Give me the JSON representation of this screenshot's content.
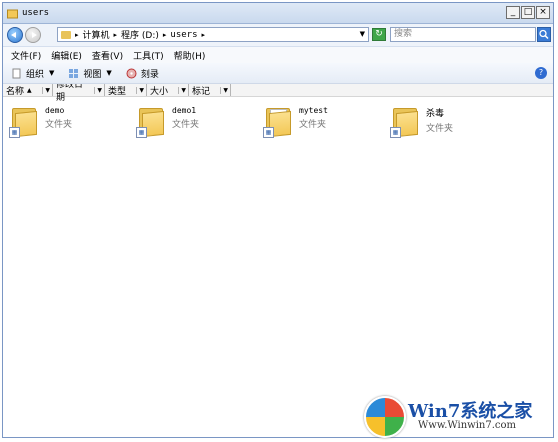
{
  "window": {
    "title": "users",
    "controls": {
      "minimize": "_",
      "restore": "□",
      "close": "×"
    }
  },
  "address": {
    "crumbs": [
      "计算机",
      "程序 (D:)",
      "users"
    ],
    "search_placeholder": "搜索"
  },
  "menu": {
    "items": [
      "文件(F)",
      "编辑(E)",
      "查看(V)",
      "工具(T)",
      "帮助(H)"
    ]
  },
  "toolbar": {
    "organize": "组织",
    "views": "视图",
    "burn": "刻录"
  },
  "columns": [
    "名称",
    "修改日期",
    "类型",
    "大小",
    "标记"
  ],
  "items": [
    {
      "name": "demo",
      "type": "文件夹"
    },
    {
      "name": "demo1",
      "type": "文件夹"
    },
    {
      "name": "mytest",
      "type": "文件夹"
    },
    {
      "name": "杀毒",
      "type": "文件夹"
    }
  ],
  "watermark": {
    "main": "Win7系统之家",
    "sub": "Www.Winwin7.com"
  },
  "colors": {
    "accent": "#2e77d0",
    "folder": "#f3c857"
  }
}
